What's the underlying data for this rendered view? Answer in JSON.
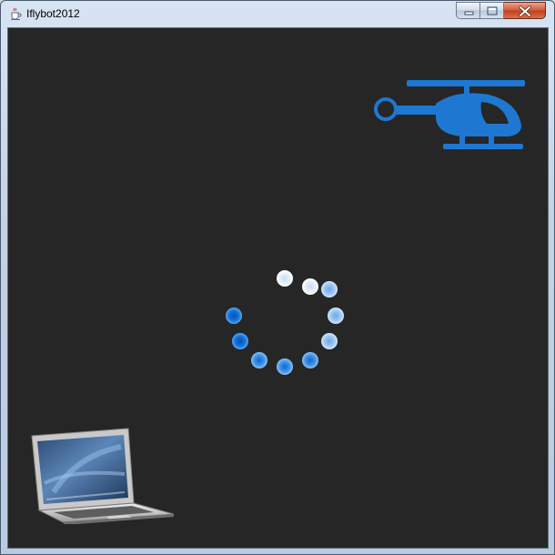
{
  "window": {
    "title": "Iflybot2012",
    "app_icon": "java-cup-icon",
    "controls": {
      "minimize": "minimize-icon",
      "maximize": "maximize-icon",
      "close": "close-icon"
    }
  },
  "canvas": {
    "background": "#262626",
    "helicopter": {
      "icon": "helicopter-icon",
      "color": "#1e78d2"
    },
    "laptop": {
      "icon": "laptop-icon"
    },
    "loading_spinner": {
      "icon": "loading-spinner",
      "dot_count": 10,
      "visible_dots": 9,
      "colors": [
        "#0d6fd8",
        "#3a8fe6",
        "#8fbff2",
        "#e6f0fb"
      ]
    }
  }
}
